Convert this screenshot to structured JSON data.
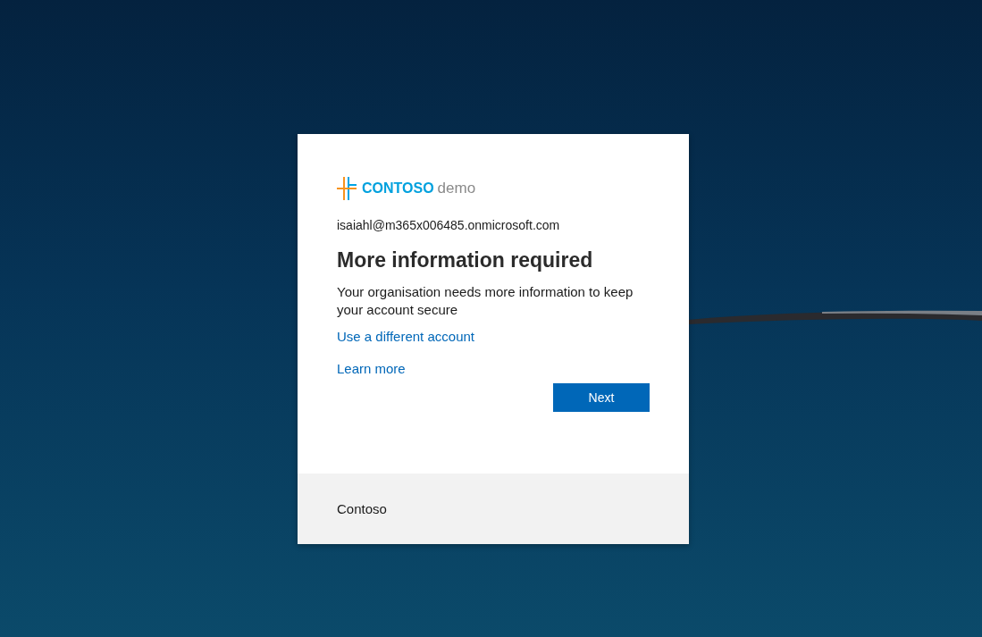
{
  "logo": {
    "brand": "CONTOSO",
    "suffix": "demo"
  },
  "account": "isaiahl@m365x006485.onmicrosoft.com",
  "title": "More information required",
  "message": "Your organisation needs more information to keep your account secure",
  "links": [
    "Use a different account",
    "Learn more"
  ],
  "button": "Next",
  "footer": "Contoso"
}
